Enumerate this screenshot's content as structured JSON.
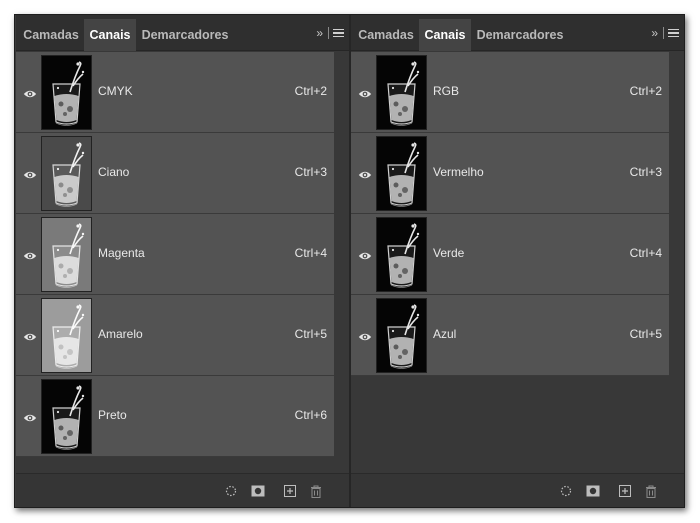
{
  "left_panel": {
    "tabs": [
      {
        "label": "Camadas",
        "active": false
      },
      {
        "label": "Canais",
        "active": true
      },
      {
        "label": "Demarcadores",
        "active": false
      }
    ],
    "overflow_label": "»",
    "channels": [
      {
        "name": "CMYK",
        "shortcut": "Ctrl+2",
        "thumb": "dark"
      },
      {
        "name": "Ciano",
        "shortcut": "Ctrl+3",
        "thumb": "mid"
      },
      {
        "name": "Magenta",
        "shortcut": "Ctrl+4",
        "thumb": "light"
      },
      {
        "name": "Amarelo",
        "shortcut": "Ctrl+5",
        "thumb": "lightest"
      },
      {
        "name": "Preto",
        "shortcut": "Ctrl+6",
        "thumb": "dark"
      }
    ]
  },
  "right_panel": {
    "tabs": [
      {
        "label": "Camadas",
        "active": false
      },
      {
        "label": "Canais",
        "active": true
      },
      {
        "label": "Demarcadores",
        "active": false
      }
    ],
    "overflow_label": "»",
    "channels": [
      {
        "name": "RGB",
        "shortcut": "Ctrl+2",
        "thumb": "dark"
      },
      {
        "name": "Vermelho",
        "shortcut": "Ctrl+3",
        "thumb": "dark"
      },
      {
        "name": "Verde",
        "shortcut": "Ctrl+4",
        "thumb": "dark"
      },
      {
        "name": "Azul",
        "shortcut": "Ctrl+5",
        "thumb": "dark"
      }
    ]
  },
  "footer_icons": [
    "load-selection-icon",
    "save-selection-icon",
    "new-channel-icon",
    "delete-channel-icon"
  ],
  "colors": {
    "panel_bg": "#383838",
    "row_bg": "#535353",
    "tab_active_bg": "#444444",
    "text": "#e8e8e8"
  }
}
